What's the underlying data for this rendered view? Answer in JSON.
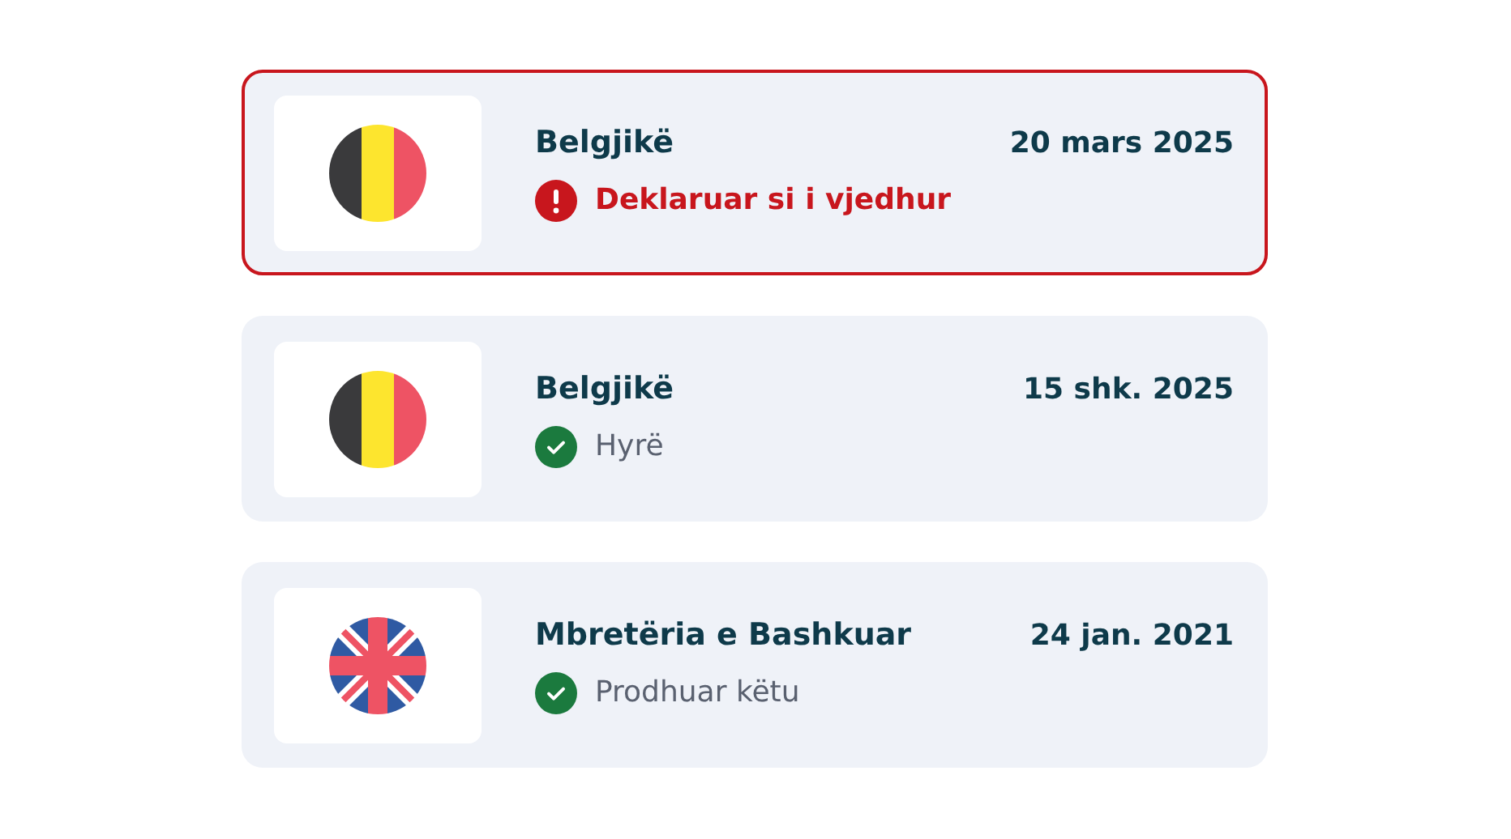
{
  "records": [
    {
      "country": "Belgjikë",
      "flag": {
        "kind": "belgium"
      },
      "date": "20 mars 2025",
      "status": {
        "kind": "alert",
        "text": "Deklaruar si i vjedhur"
      }
    },
    {
      "country": "Belgjikë",
      "flag": {
        "kind": "belgium"
      },
      "date": "15 shk. 2025",
      "status": {
        "kind": "ok",
        "text": "Hyrë"
      }
    },
    {
      "country": "Mbretëria e Bashkuar",
      "flag": {
        "kind": "uk"
      },
      "date": "24 jan. 2021",
      "status": {
        "kind": "ok",
        "text": "Prodhuar këtu"
      }
    }
  ]
}
